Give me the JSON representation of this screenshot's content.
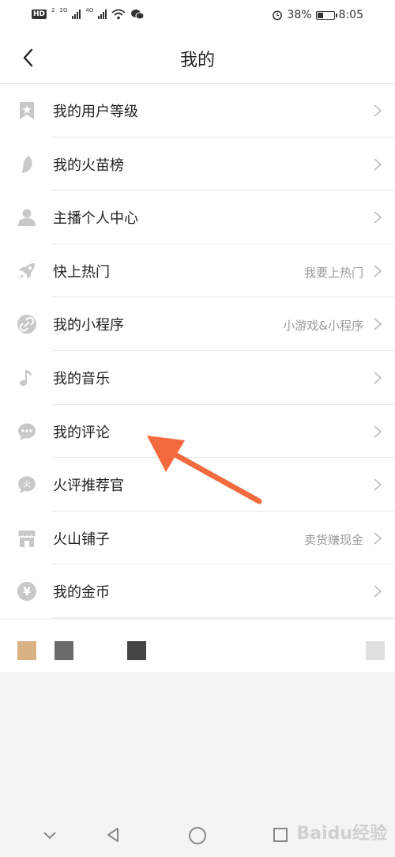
{
  "status_bar": {
    "hd": "HD",
    "hd_sub": "2",
    "net_1": "2G",
    "net_2": "4G",
    "battery": "38%",
    "time": "8:05",
    "battery_level": 0.38
  },
  "header": {
    "title": "我的"
  },
  "menu": [
    {
      "label": "我的用户等级",
      "hint": "",
      "icon": "bookmark-star-icon"
    },
    {
      "label": "我的火苗榜",
      "hint": "",
      "icon": "flame-icon"
    },
    {
      "label": "主播个人中心",
      "hint": "",
      "icon": "person-icon"
    },
    {
      "label": "快上热门",
      "hint": "我要上热门",
      "icon": "rocket-icon"
    },
    {
      "label": "我的小程序",
      "hint": "小游戏&小程序",
      "icon": "link-icon"
    },
    {
      "label": "我的音乐",
      "hint": "",
      "icon": "music-note-icon"
    },
    {
      "label": "我的评论",
      "hint": "",
      "icon": "chat-bubble-icon"
    },
    {
      "label": "火评推荐官",
      "hint": "",
      "icon": "fire-badge-icon"
    },
    {
      "label": "火山铺子",
      "hint": "卖货赚现金",
      "icon": "shop-icon"
    },
    {
      "label": "我的金币",
      "hint": "",
      "icon": "yen-coin-icon"
    }
  ],
  "fire_badge_char": "火",
  "yen_char": "¥",
  "colors": {
    "icon_gray": "#c8c8c8",
    "arrow_orange": "#f26a3d",
    "swatch_1": "#d9b383",
    "swatch_2": "#6b6b6b",
    "swatch_3": "#444444",
    "swatch_4": "#e0e0e0"
  },
  "watermark": "Baidu经验"
}
